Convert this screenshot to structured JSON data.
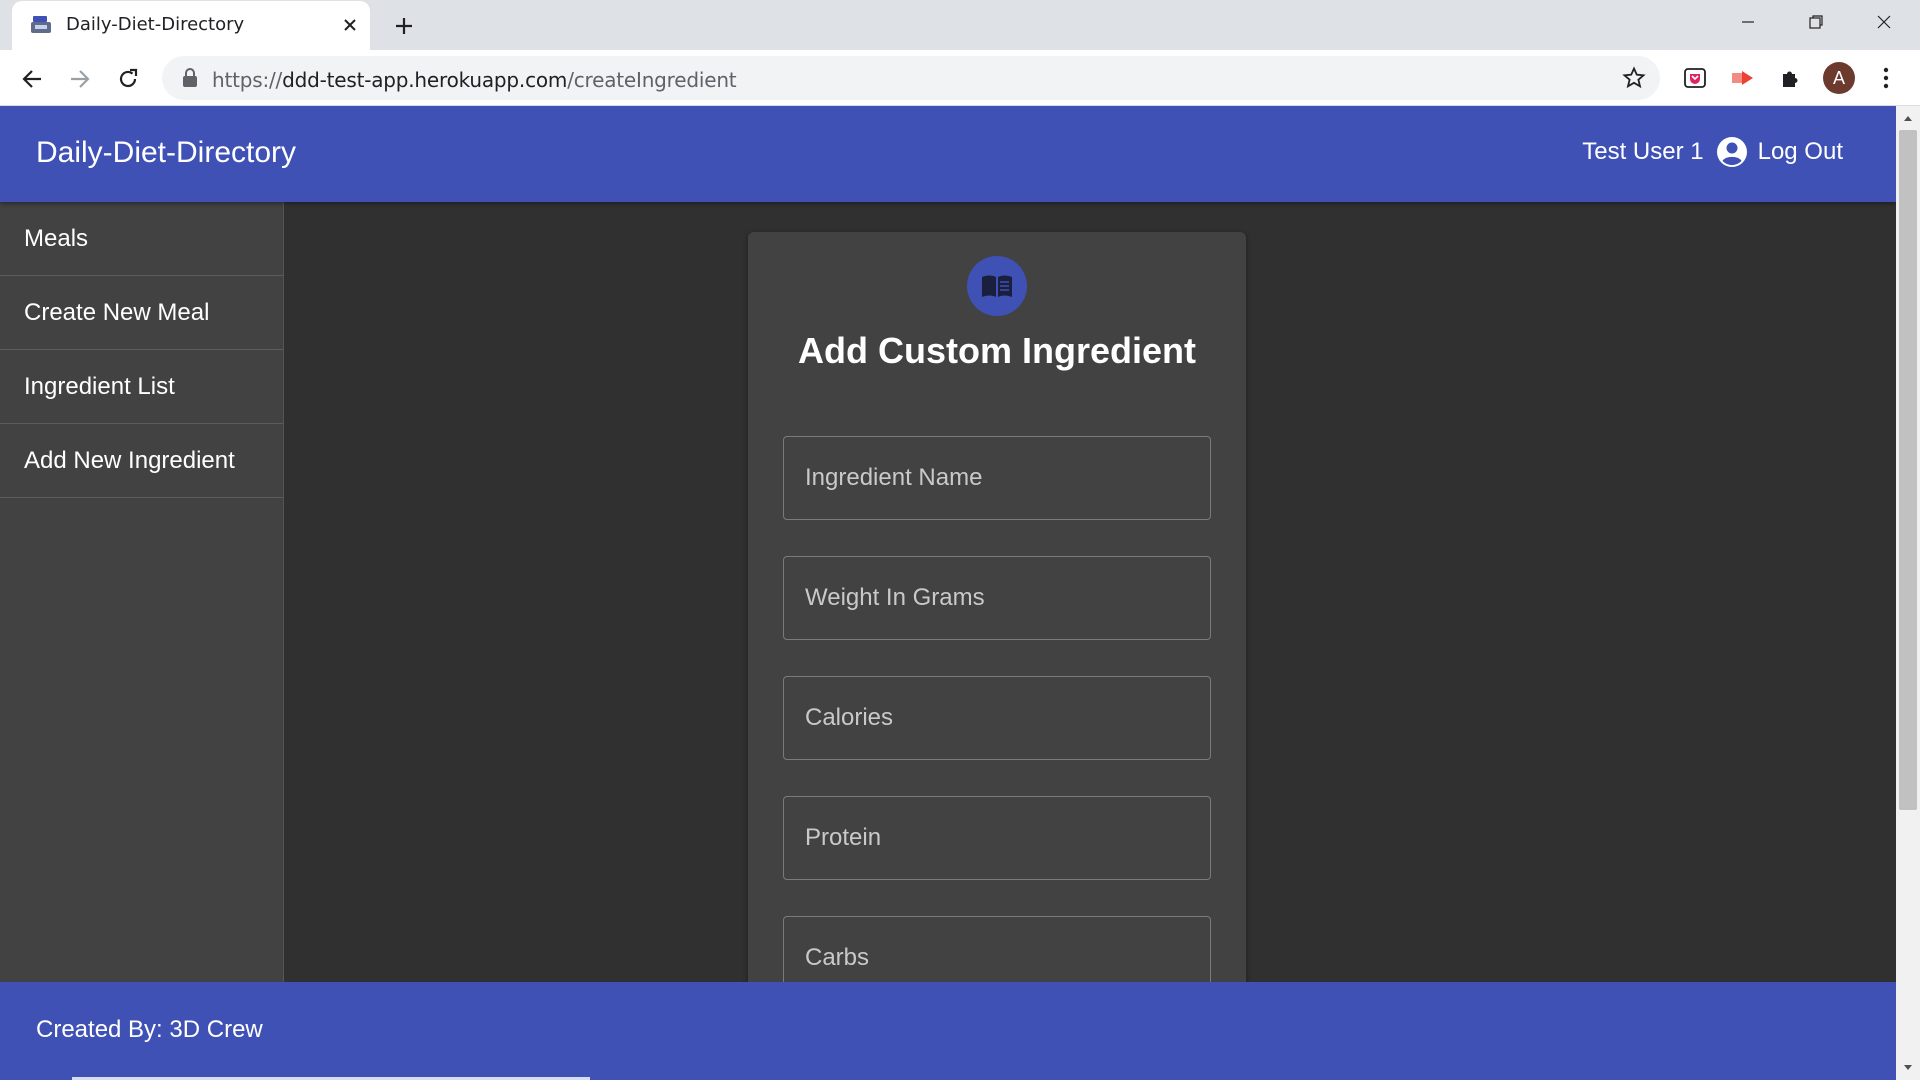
{
  "browser": {
    "tab_title": "Daily-Diet-Directory",
    "url_scheme": "https://",
    "url_host": "ddd-test-app.herokuapp.com",
    "url_path": "/createIngredient",
    "profile_initial": "A"
  },
  "app": {
    "title": "Daily-Diet-Directory",
    "user_name": "Test User 1",
    "logout_label": "Log Out",
    "brand_color": "#3f51b5"
  },
  "sidebar": {
    "items": [
      {
        "label": "Meals"
      },
      {
        "label": "Create New Meal"
      },
      {
        "label": "Ingredient List"
      },
      {
        "label": "Add New Ingredient"
      }
    ]
  },
  "form": {
    "icon": "book-icon",
    "title": "Add Custom Ingredient",
    "fields": [
      {
        "placeholder": "Ingredient Name"
      },
      {
        "placeholder": "Weight In Grams"
      },
      {
        "placeholder": "Calories"
      },
      {
        "placeholder": "Protein"
      },
      {
        "placeholder": "Carbs"
      }
    ]
  },
  "footer": {
    "text": "Created By: 3D Crew"
  }
}
